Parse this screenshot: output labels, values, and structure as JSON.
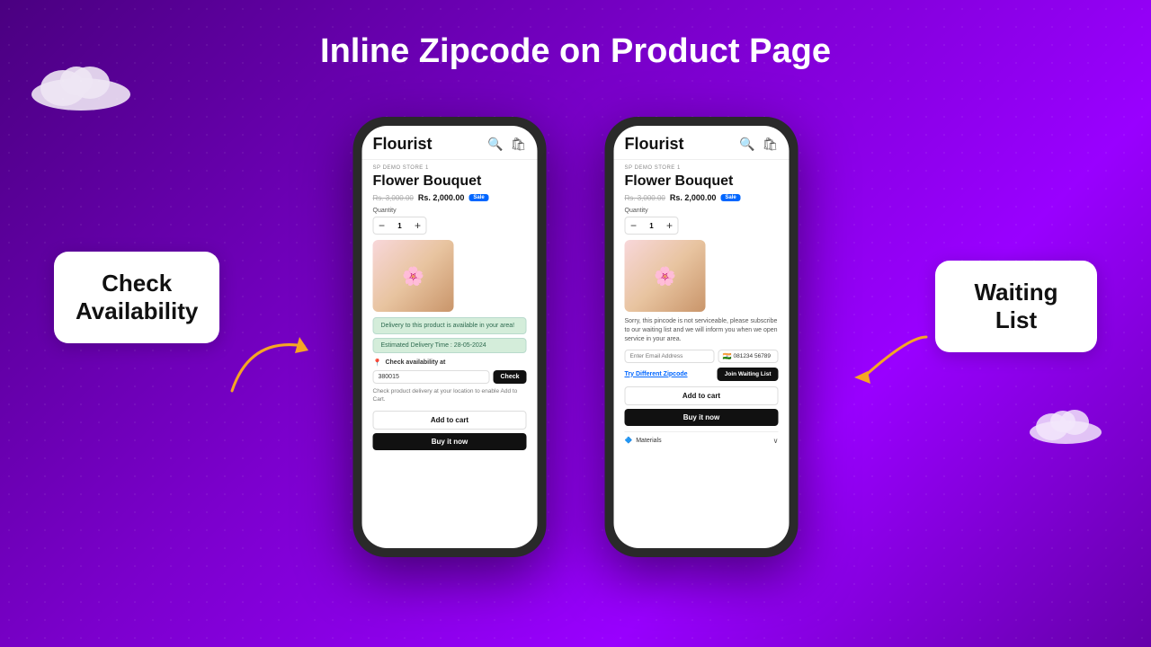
{
  "page": {
    "title": "Inline Zipcode on Product Page",
    "background_gradient": "purple"
  },
  "callout_left": {
    "label": "Check\nAvailability"
  },
  "callout_right": {
    "label": "Waiting\nList"
  },
  "phone1": {
    "store_name": "Flourist",
    "store_label": "SP DEMO STORE 1",
    "product_title": "Flower Bouquet",
    "price_original": "Rs. 3,000.00",
    "price_current": "Rs. 2,000.00",
    "sale_badge": "Sale",
    "qty_label": "Quantity",
    "qty_minus": "−",
    "qty_value": "1",
    "qty_plus": "+",
    "availability_success": "Delivery to this product is available in your area!",
    "estimated_delivery": "Estimated Delivery Time : 28-05-2024",
    "check_availability_label": "Check availability at",
    "zipcode_value": "380015",
    "check_button": "Check",
    "delivery_hint": "Check product delivery at your location to enable Add to Cart.",
    "add_to_cart": "Add to cart",
    "buy_now": "Buy it now"
  },
  "phone2": {
    "store_name": "Flourist",
    "store_label": "SP DEMO STORE 1",
    "product_title": "Flower Bouquet",
    "price_original": "Rs. 3,000.00",
    "price_current": "Rs. 2,000.00",
    "sale_badge": "Sale",
    "qty_label": "Quantity",
    "qty_minus": "−",
    "qty_value": "1",
    "qty_plus": "+",
    "sorry_text": "Sorry, this pincode is not serviceable, please subscribe to our waiting list and we will inform you when we open service in your area.",
    "email_placeholder": "Enter Email Address",
    "phone_number": "081234 56789",
    "try_different_link": "Try Different Zipcode",
    "join_waiting_button": "Join Waiting List",
    "add_to_cart": "Add to cart",
    "buy_now": "Buy it now",
    "materials_label": "Materials"
  }
}
